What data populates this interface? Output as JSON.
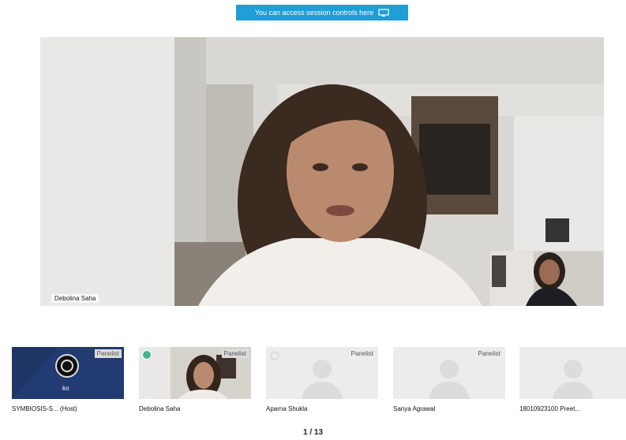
{
  "banner": {
    "text": "You can access session controls here"
  },
  "main_video": {
    "speaker_name": "Debolina Saha"
  },
  "participants": [
    {
      "name": "SYMBIOSIS-S... (Host)",
      "badge": "Panelist",
      "tile_text": "ko"
    },
    {
      "name": "Debolina Saha",
      "badge": "Panelist"
    },
    {
      "name": "Aparna Shukla",
      "badge": "Panelist"
    },
    {
      "name": "Sanya Agrawal",
      "badge": "Panelist"
    },
    {
      "name": "18010923100 Preet...",
      "badge": ""
    }
  ],
  "pager": {
    "text": "1 / 13"
  },
  "colors": {
    "banner": "#1f9ed8",
    "host_tile": "#1e3566"
  }
}
